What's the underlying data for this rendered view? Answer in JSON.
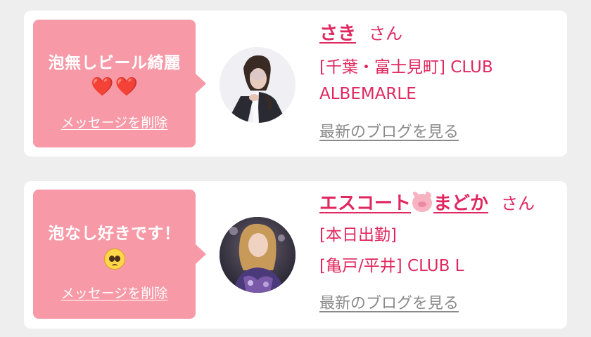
{
  "messages": [
    {
      "message": "泡無しビール綺麗",
      "emoji": [
        "❤️",
        "❤️"
      ],
      "emoji_icon": "heart-icon",
      "delete_label": "メッセージを削除",
      "name": "さき",
      "honorific": "さん",
      "info_line1": "[千葉・富士見町] CLUB",
      "info_line2": "ALBEMARLE",
      "blog_label": "最新のブログを見る"
    },
    {
      "message": "泡なし好きです！",
      "emoji_icon": "pleading-face-icon",
      "delete_label": "メッセージを削除",
      "name_part1": "エスコート",
      "name_icon": "pig-face-icon",
      "name_part2": "まどか",
      "honorific": "さん",
      "info_line1": "[本日出勤]",
      "info_line2": "[亀戸/平井] CLUB L",
      "blog_label": "最新のブログを見る"
    }
  ],
  "colors": {
    "bubble": "#f799a6",
    "accent_text": "#e02860",
    "link_gray": "#8a8a8a",
    "background": "#eeeeee"
  }
}
